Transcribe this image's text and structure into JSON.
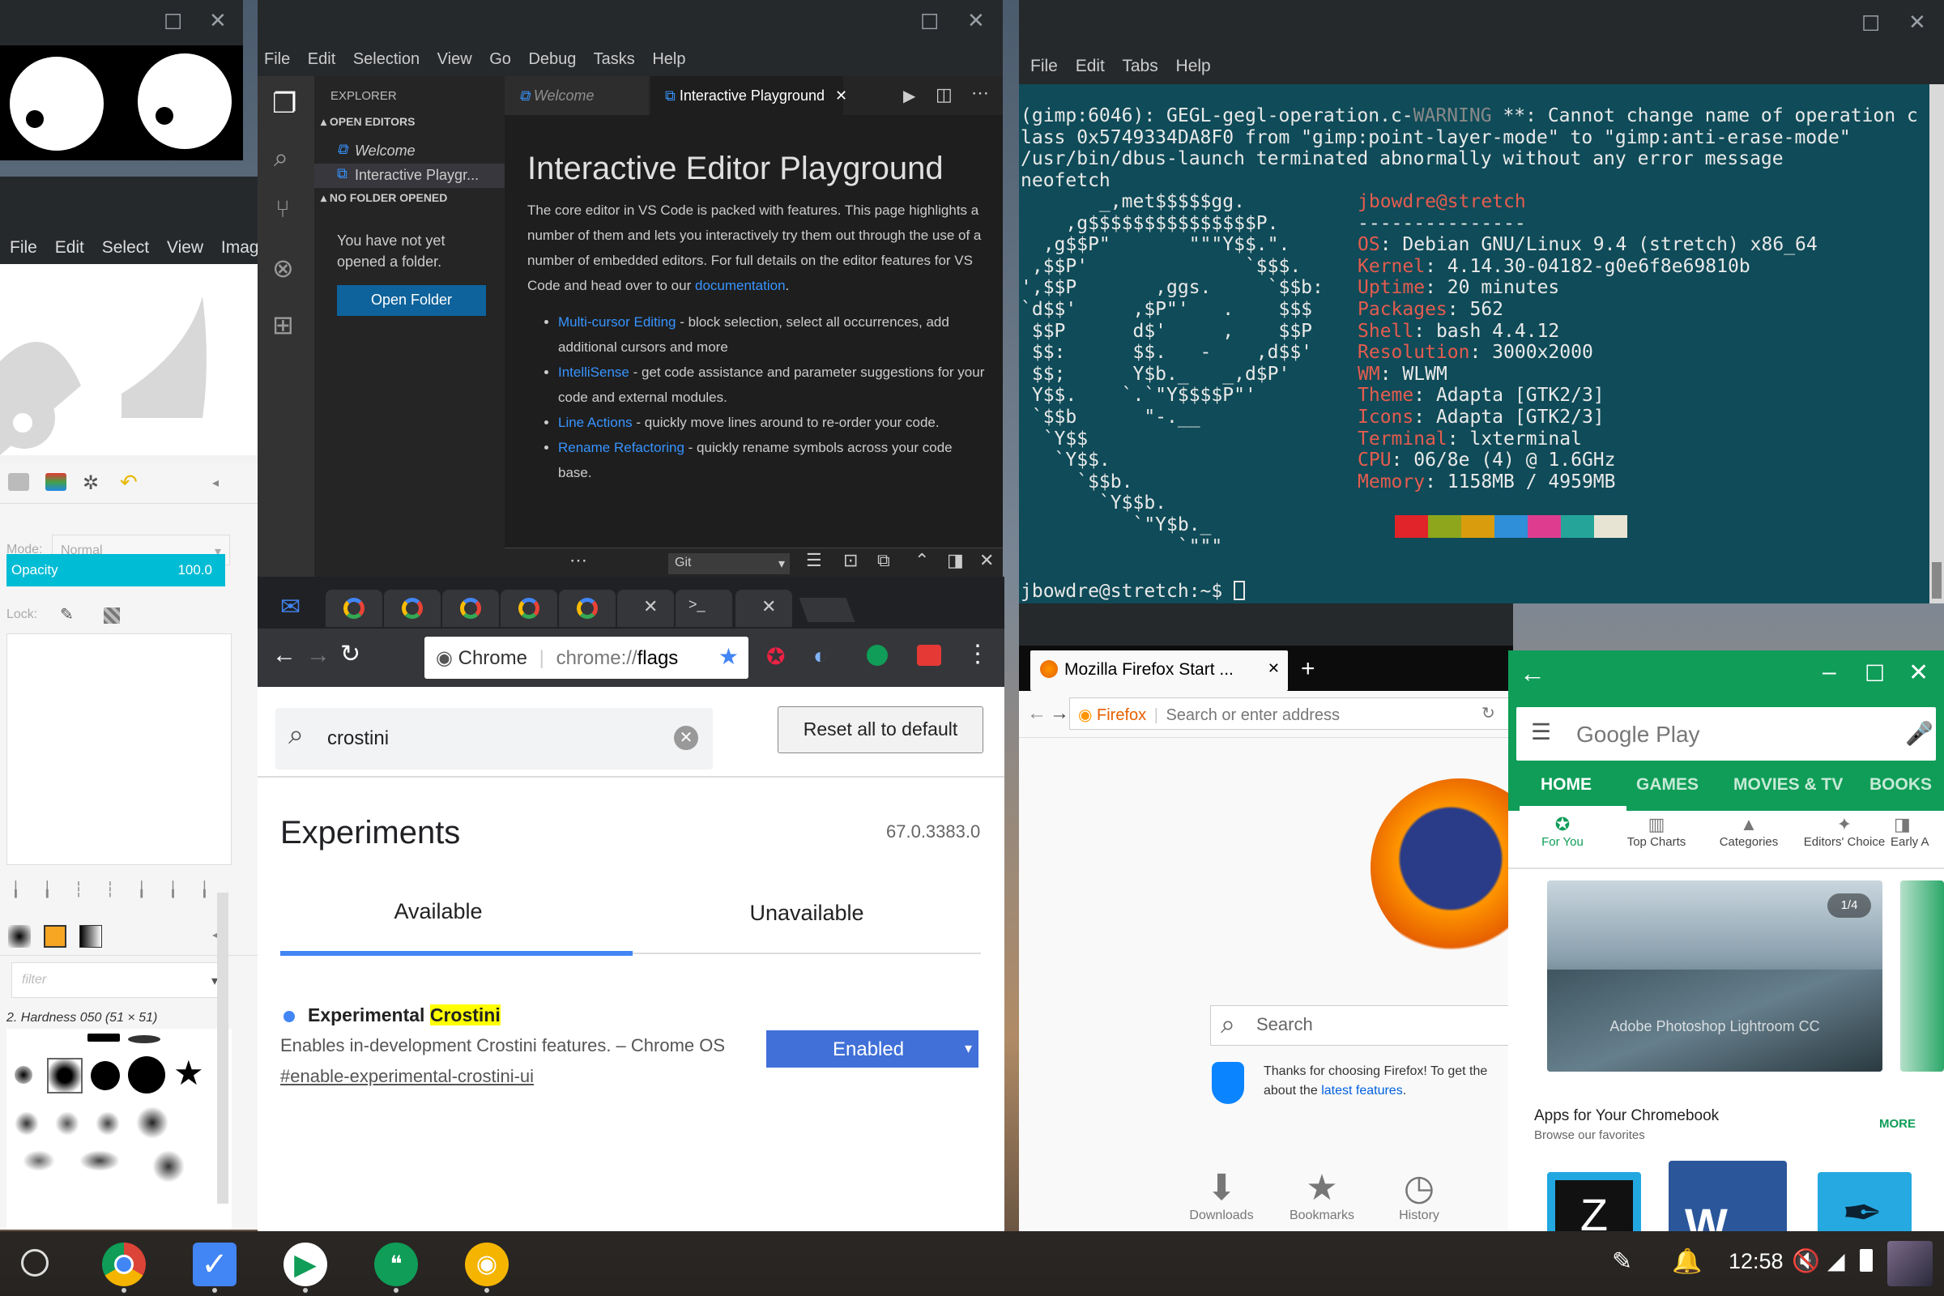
{
  "gimp_main": {
    "menu": [
      "File",
      "Edit",
      "Select",
      "View",
      "Imag"
    ],
    "mode_label": "Mode:",
    "mode_value": "Normal",
    "opacity_label": "Opacity",
    "opacity_value": "100.0",
    "lock_label": "Lock:",
    "filter_placeholder": "filter",
    "brush_name": "2. Hardness 050 (51 × 51)"
  },
  "vscode": {
    "menu": [
      "File",
      "Edit",
      "Selection",
      "View",
      "Go",
      "Debug",
      "Tasks",
      "Help"
    ],
    "explorer_title": "EXPLORER",
    "open_editors_title": "OPEN EDITORS",
    "open_editors": [
      "Welcome",
      "Interactive Playgr..."
    ],
    "no_folder_title": "NO FOLDER OPENED",
    "no_folder_msg": "You have not yet opened a folder.",
    "open_folder_button": "Open Folder",
    "tabs": [
      "Welcome",
      "Interactive Playground"
    ],
    "doc_title": "Interactive Editor Playground",
    "doc_intro": "The core editor in VS Code is packed with features. This page highlights a number of them and lets you interactively try them out through the use of a number of embedded editors. For full details on the editor features for VS Code and head over to our",
    "doc_link": "documentation",
    "features": [
      {
        "link": "Multi-cursor Editing",
        "text": " - block selection, select all occurrences, add additional cursors and more"
      },
      {
        "link": "IntelliSense",
        "text": " - get code assistance and parameter suggestions for your code and external modules."
      },
      {
        "link": "Line Actions",
        "text": " - quickly move lines around to re-order your code."
      },
      {
        "link": "Rename Refactoring",
        "text": " - quickly rename symbols across your code base."
      }
    ],
    "panel_dropdown": "Git"
  },
  "terminal": {
    "menu": [
      "File",
      "Edit",
      "Tabs",
      "Help"
    ],
    "log_lines": [
      "(gimp:6046): GEGL-gegl-operation.c-WARNING **: Cannot change name of operation c",
      "lass 0x5749334DA8F0 from \"gimp:point-layer-mode\" to \"gimp:anti-erase-mode\"",
      "/usr/bin/dbus-launch terminated abnormally without any error message",
      "neofetch"
    ],
    "warning_word": "WARNING",
    "logo_lines": [
      "       _,met$$$$$gg.",
      "    ,g$$$$$$$$$$$$$$$P.",
      "  ,g$$P\"       \"\"\"Y$$.\".",
      " ,$$P'              `$$$.",
      "',$$P       ,ggs.     `$$b:",
      "`d$$'     ,$P\"'   .    $$$",
      " $$P      d$'     ,    $$P",
      " $$:      $$.   -    ,d$$'",
      " $$;      Y$b._   _,d$P'",
      " Y$$.    `.`\"Y$$$$P\"'",
      " `$$b      \"-.__",
      "  `Y$$",
      "   `Y$$.",
      "     `$$b.",
      "       `Y$$b.",
      "          `\"Y$b._",
      "              `\"\"\""
    ],
    "user_host": "jbowdre@stretch",
    "separator": "---------------",
    "info": [
      {
        "key": "OS",
        "value": "Debian GNU/Linux 9.4 (stretch) x86_64"
      },
      {
        "key": "Kernel",
        "value": "4.14.30-04182-g0e6f8e69810b"
      },
      {
        "key": "Uptime",
        "value": "20 minutes"
      },
      {
        "key": "Packages",
        "value": "562"
      },
      {
        "key": "Shell",
        "value": "bash 4.4.12"
      },
      {
        "key": "Resolution",
        "value": "3000x2000"
      },
      {
        "key": "WM",
        "value": "WLWM"
      },
      {
        "key": "Theme",
        "value": "Adapta [GTK2/3]"
      },
      {
        "key": "Icons",
        "value": "Adapta [GTK2/3]"
      },
      {
        "key": "Terminal",
        "value": "lxterminal"
      },
      {
        "key": "CPU",
        "value": "06/8e (4) @ 1.6GHz"
      },
      {
        "key": "Memory",
        "value": "1158MB / 4959MB"
      }
    ],
    "palette": [
      "#e0242a",
      "#8da61b",
      "#d99c0d",
      "#2f8fd8",
      "#de3d8f",
      "#25a59a",
      "#e8e4d4"
    ],
    "prompt": "jbowdre@stretch:~$ "
  },
  "chrome": {
    "omnibox_site": "Chrome",
    "omnibox_url_prefix": "chrome://",
    "omnibox_url_path": "flags",
    "search_value": "crostini",
    "reset_button": "Reset all to default",
    "heading": "Experiments",
    "version": "67.0.3383.0",
    "tab_available": "Available",
    "tab_unavailable": "Unavailable",
    "flag_title_prefix": "Experimental ",
    "flag_title_highlight": "Crostini",
    "flag_description": "Enables in-development Crostini features. – Chrome OS",
    "flag_anchor": "#enable-experimental-crostini-ui",
    "flag_state": "Enabled"
  },
  "firefox": {
    "tab_title": "Mozilla Firefox Start ...",
    "identity": "Firefox",
    "url_placeholder": "Search or enter address",
    "search_placeholder": "Search",
    "snippet_text": "Thanks for choosing Firefox! To get the about the",
    "snippet_link": "latest features",
    "snippet_end": ".",
    "shortcuts": [
      "Downloads",
      "Bookmarks",
      "History"
    ]
  },
  "play": {
    "search_placeholder": "Google Play",
    "tabs": [
      "HOME",
      "GAMES",
      "MOVIES & TV",
      "BOOKS"
    ],
    "subtabs": [
      "For You",
      "Top Charts",
      "Categories",
      "Editors' Choice",
      "Early A"
    ],
    "banner_counter": "1/4",
    "banner_title": "Adobe Photoshop Lightroom CC",
    "section_title": "Apps for Your Chromebook",
    "section_sub": "Browse our favorites",
    "more": "MORE"
  },
  "shelf": {
    "time": "12:58"
  }
}
